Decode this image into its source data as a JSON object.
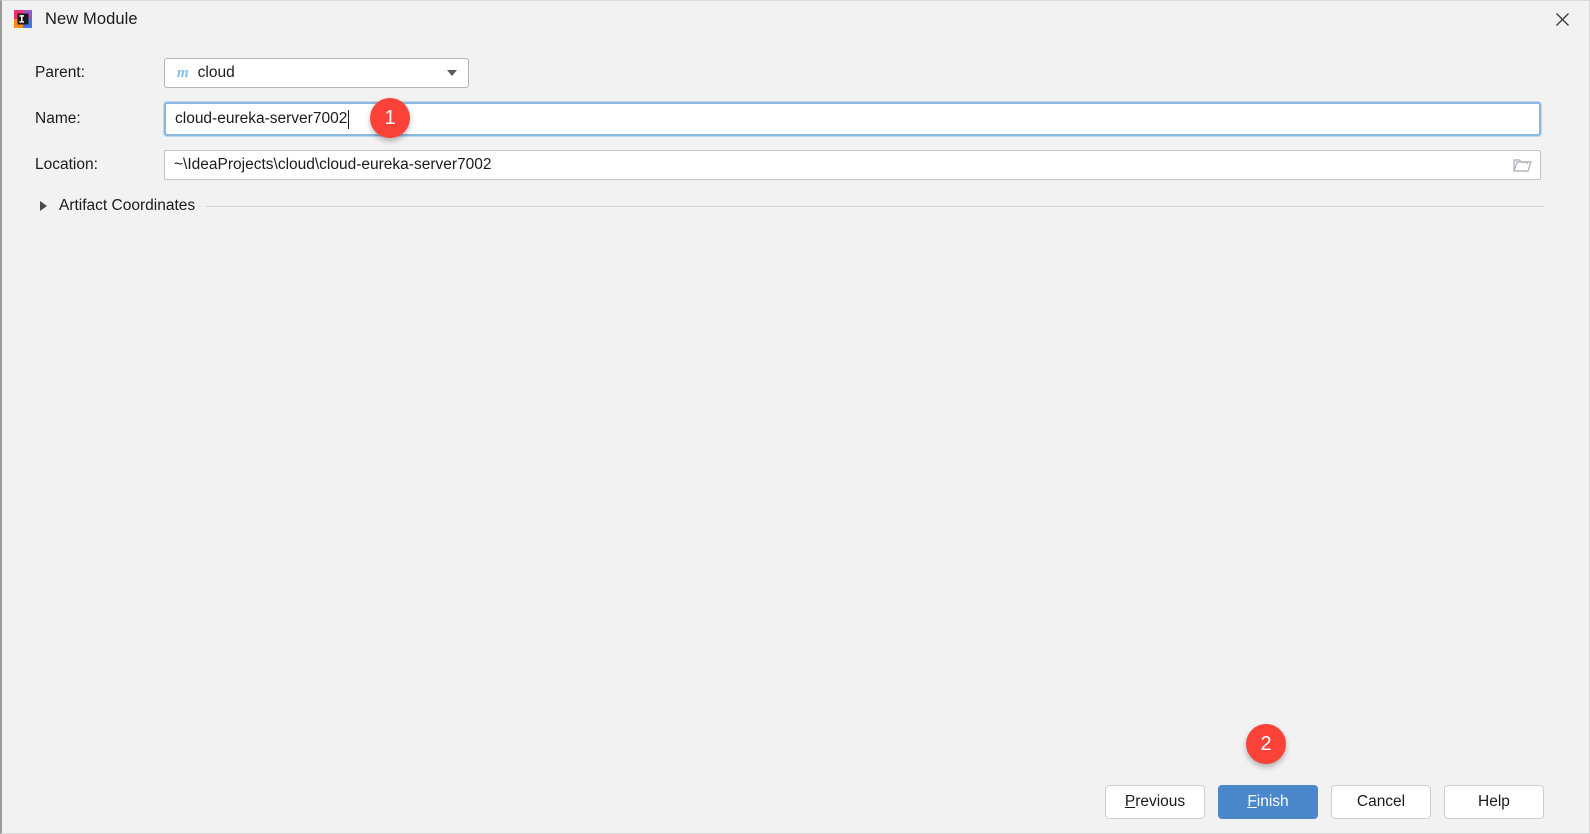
{
  "window": {
    "title": "New Module",
    "app_icon": "intellij-idea-icon",
    "close_icon": "close-icon",
    "background_color": "#f2f2f2"
  },
  "form": {
    "parent": {
      "label": "Parent:",
      "value": "cloud",
      "icon_glyph": "m",
      "icon_name": "maven-module-icon",
      "icon_color": "#7fc3e8",
      "arrow_icon": "chevron-down-icon"
    },
    "name": {
      "label": "Name:",
      "value": "cloud-eureka-server7002",
      "focused": true,
      "focus_color": "#8cb7e0"
    },
    "location": {
      "label": "Location:",
      "value": "~\\IdeaProjects\\cloud\\cloud-eureka-server7002",
      "browse_icon": "folder-browse-icon"
    }
  },
  "sections": {
    "artifact_coordinates": {
      "label": "Artifact Coordinates",
      "expanded": false,
      "disclosure_icon": "triangle-right-icon"
    }
  },
  "footer": {
    "buttons": [
      {
        "label": "Previous",
        "mnemonic": "P",
        "primary": false
      },
      {
        "label": "Finish",
        "mnemonic": "F",
        "primary": true
      },
      {
        "label": "Cancel",
        "mnemonic": "",
        "primary": false
      },
      {
        "label": "Help",
        "mnemonic": "",
        "primary": false
      }
    ],
    "previous_pre": "",
    "previous_mn": "P",
    "previous_post": "revious",
    "finish_pre": "",
    "finish_mn": "F",
    "finish_post": "inish",
    "cancel_label": "Cancel",
    "help_label": "Help",
    "primary_color": "#4a87cb"
  },
  "annotations": {
    "badge_color": "#fa4238",
    "items": [
      {
        "number": "1",
        "target": "name-input"
      },
      {
        "number": "2",
        "target": "finish-button"
      }
    ]
  }
}
